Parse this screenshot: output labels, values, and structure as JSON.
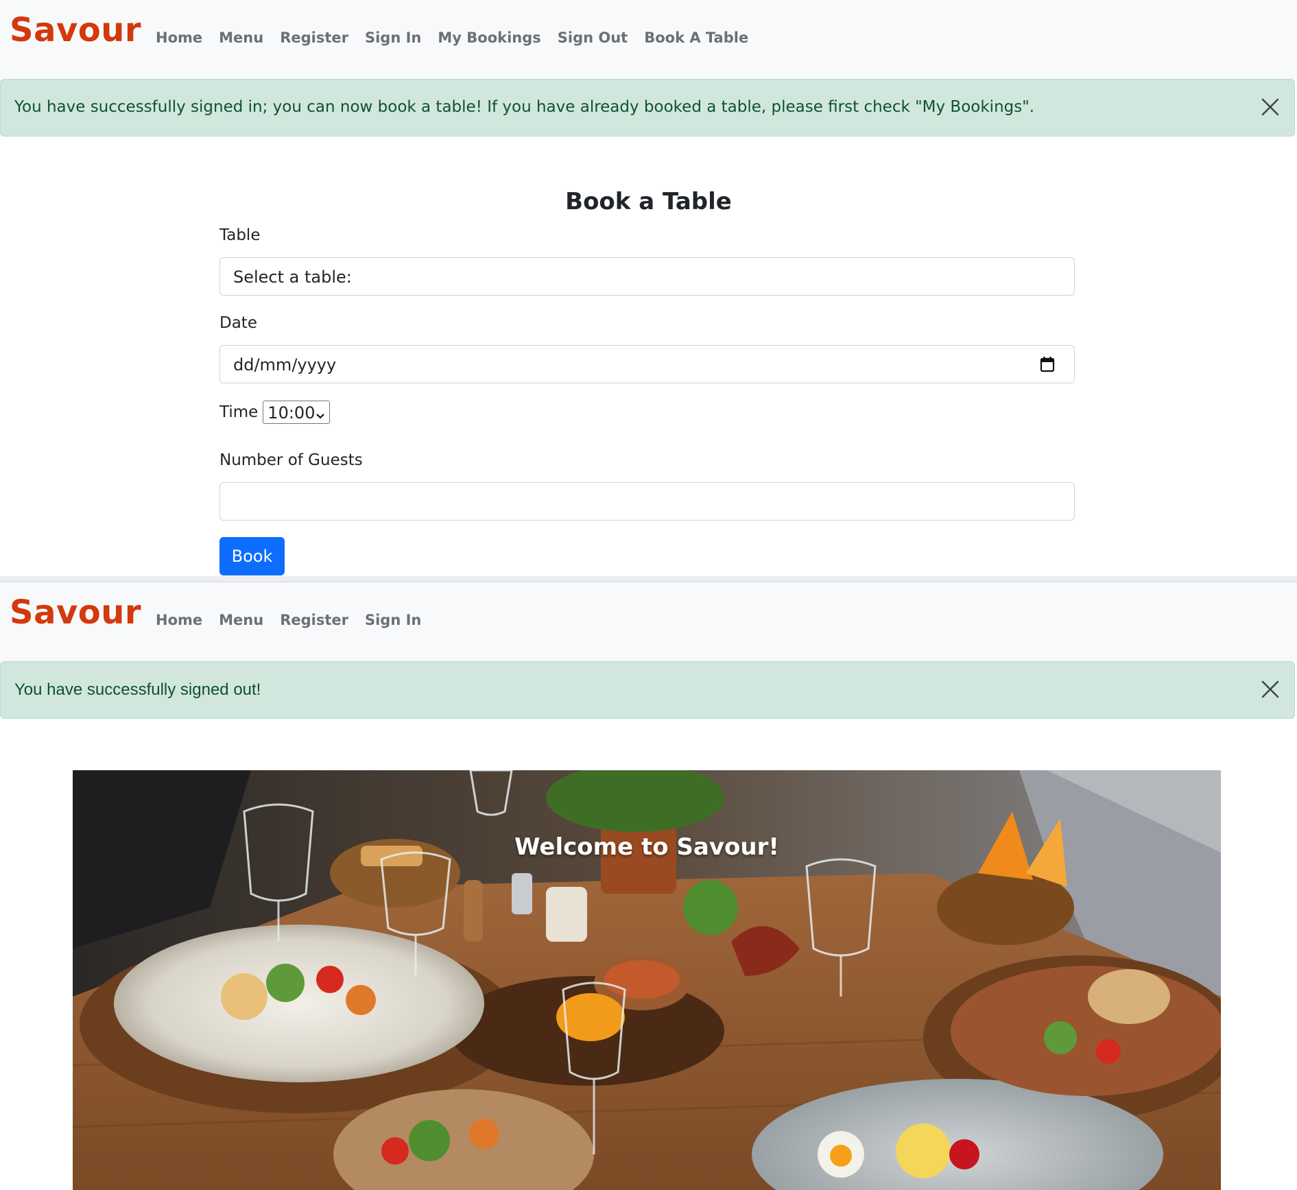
{
  "brand": "Savour",
  "screen1": {
    "nav": [
      "Home",
      "Menu",
      "Register",
      "Sign In",
      "My Bookings",
      "Sign Out",
      "Book A Table"
    ],
    "alert": "You have successfully signed in; you can now book a table! If you have already booked a table, please first check \"My Bookings\".",
    "form": {
      "title": "Book a Table",
      "table_label": "Table",
      "table_value": "Select a table:",
      "date_label": "Date",
      "date_placeholder": "dd/mm/yyyy",
      "time_label": "Time",
      "time_value": "10:00",
      "guests_label": "Number of Guests",
      "guests_value": "",
      "submit": "Book"
    }
  },
  "screen2": {
    "nav": [
      "Home",
      "Menu",
      "Register",
      "Sign In"
    ],
    "alert": "You have successfully signed out!",
    "hero_title": "Welcome to Savour!"
  },
  "colors": {
    "brand": "#d4380d",
    "alert_bg": "#d1e7dd",
    "alert_text": "#0f5132",
    "primary": "#0d6efd"
  },
  "icons": [
    "close-icon",
    "calendar-icon",
    "chevron-down-icon"
  ]
}
